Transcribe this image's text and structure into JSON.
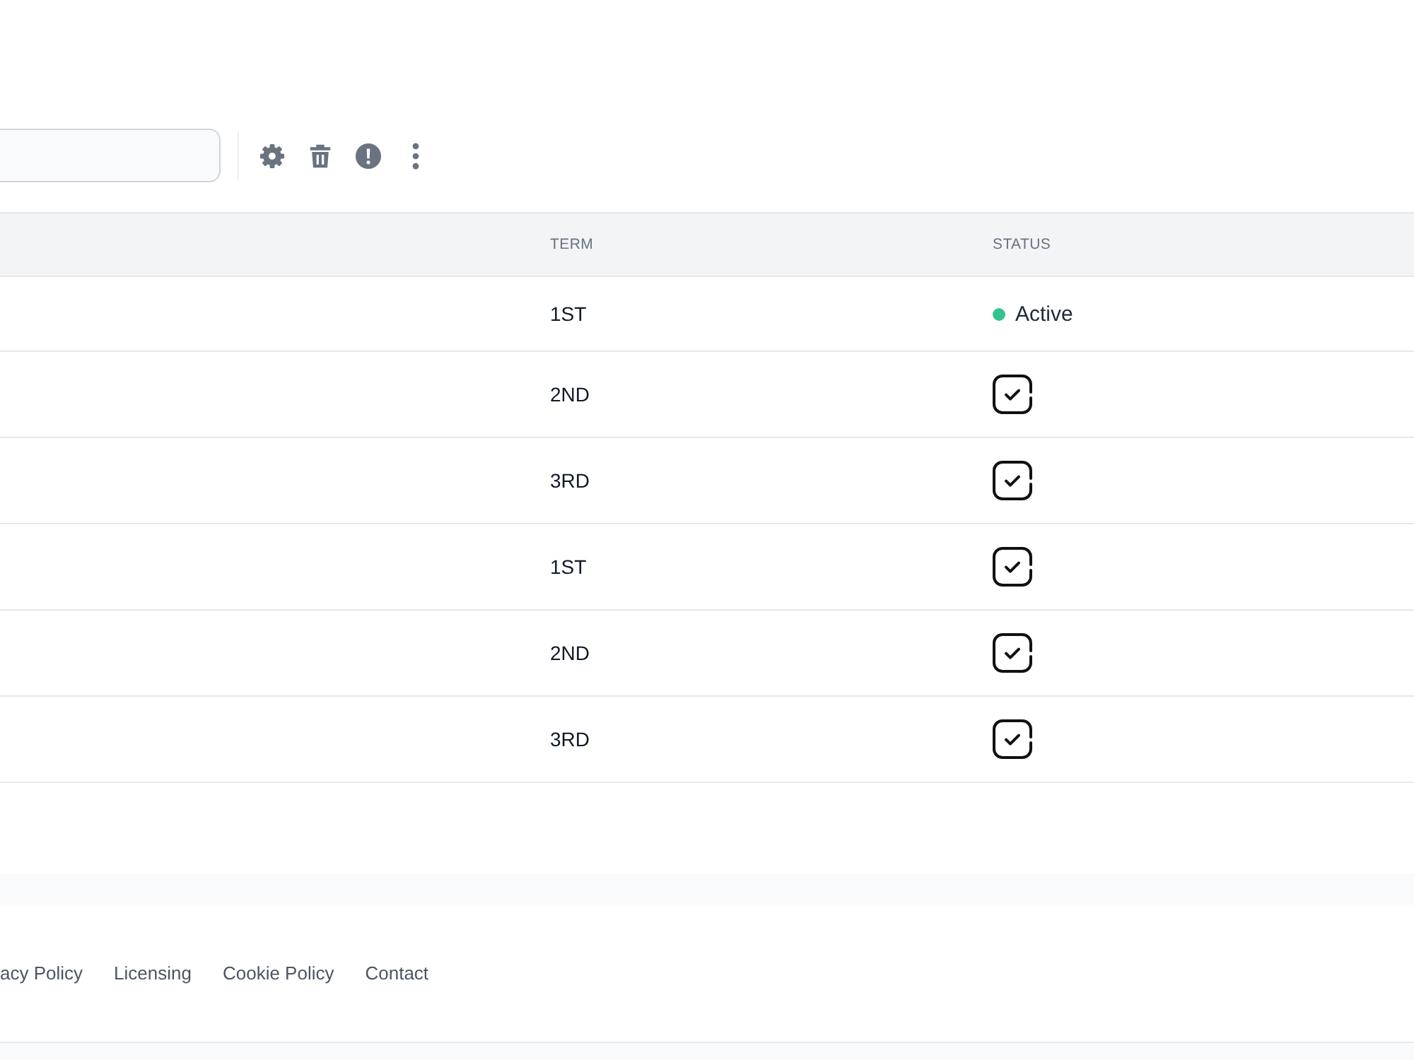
{
  "table": {
    "columns": [
      "TERM",
      "STATUS"
    ],
    "rows": [
      {
        "term": "1ST",
        "status": {
          "kind": "text",
          "label": "Active",
          "color": "#34c38f"
        }
      },
      {
        "term": "2ND",
        "status": {
          "kind": "check"
        }
      },
      {
        "term": "3RD",
        "status": {
          "kind": "check"
        }
      },
      {
        "term": "1ST",
        "status": {
          "kind": "check"
        }
      },
      {
        "term": "2ND",
        "status": {
          "kind": "check"
        }
      },
      {
        "term": "3RD",
        "status": {
          "kind": "check"
        }
      }
    ]
  },
  "footer": {
    "links": [
      "acy Policy",
      "Licensing",
      "Cookie Policy",
      "Contact"
    ]
  }
}
